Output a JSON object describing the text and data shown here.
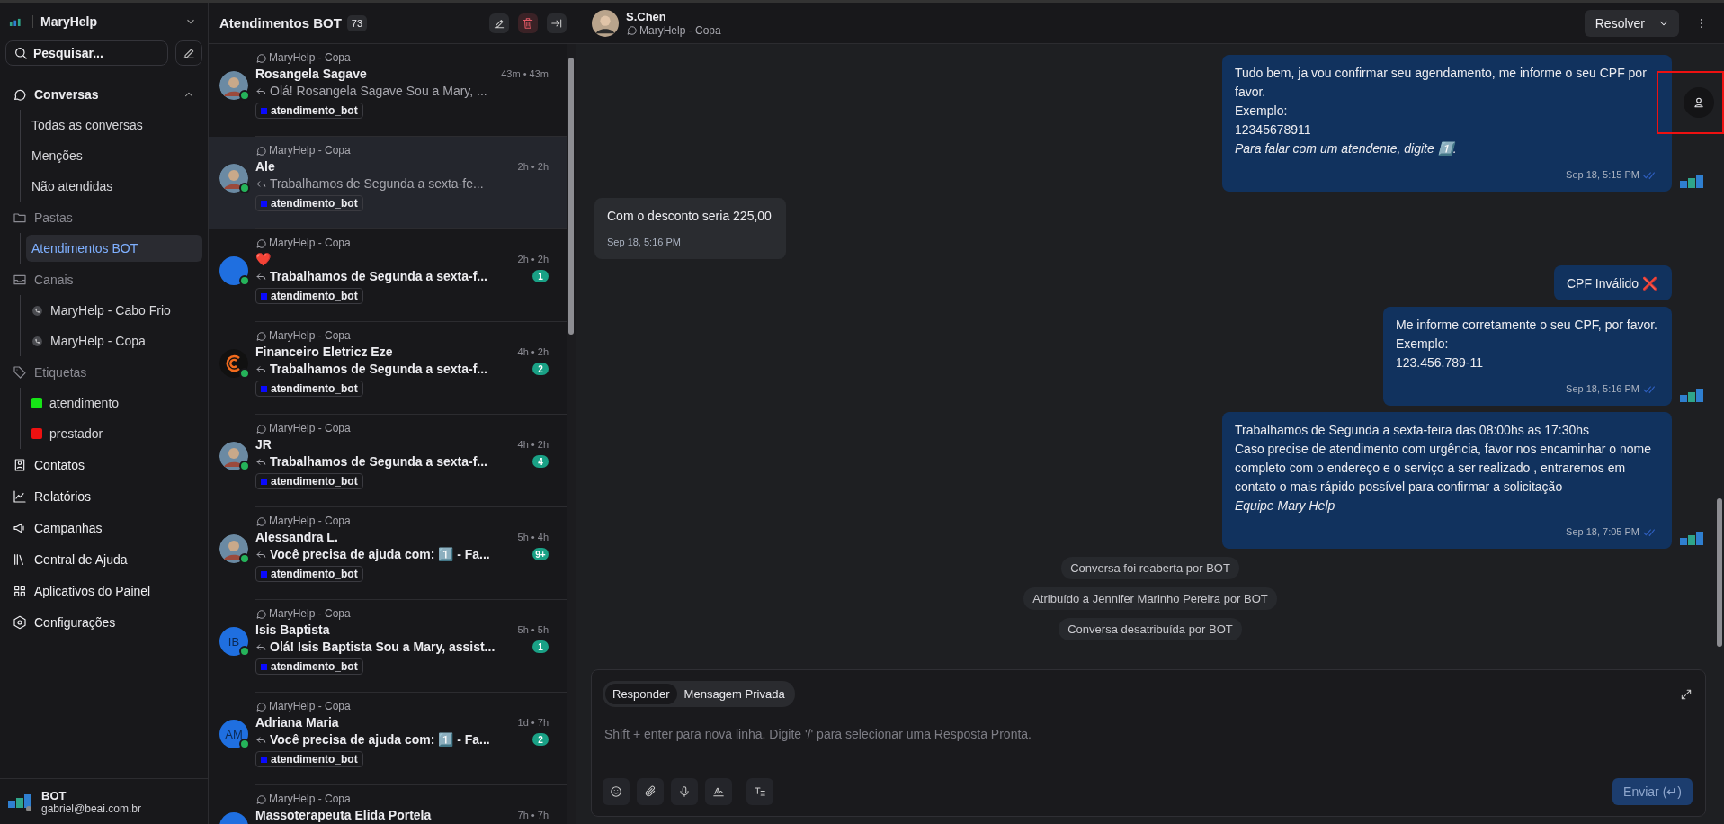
{
  "sidebar": {
    "brand": "MaryHelp",
    "search": {
      "label": "Pesquisar..."
    },
    "nav": [
      {
        "kind": "section",
        "label": "Conversas",
        "expanded": true,
        "children": [
          {
            "kind": "view",
            "label": "Todas as conversas",
            "selected": false
          },
          {
            "kind": "view",
            "label": "Menções",
            "selected": false
          },
          {
            "kind": "view",
            "label": "Não atendidas",
            "selected": false
          }
        ]
      },
      {
        "kind": "group",
        "label": "Pastas",
        "children": [
          {
            "kind": "folder",
            "label": "Atendimentos BOT",
            "selected": true
          }
        ]
      },
      {
        "kind": "group",
        "label": "Canais",
        "children": [
          {
            "kind": "channel",
            "label": "MaryHelp - Cabo Frio",
            "selected": false
          },
          {
            "kind": "channel",
            "label": "MaryHelp - Copa",
            "selected": false
          }
        ]
      },
      {
        "kind": "group",
        "label": "Etiquetas",
        "children": [
          {
            "kind": "label",
            "label": "atendimento",
            "selected": false,
            "color": "#16e316"
          },
          {
            "kind": "label",
            "label": "prestador",
            "selected": false,
            "color": "#ee1111"
          }
        ]
      },
      {
        "kind": "link",
        "label": "Contatos"
      },
      {
        "kind": "link",
        "label": "Relatórios"
      },
      {
        "kind": "link",
        "label": "Campanhas"
      },
      {
        "kind": "link",
        "label": "Central de Ajuda"
      },
      {
        "kind": "link",
        "label": "Aplicativos do Painel"
      },
      {
        "kind": "link",
        "label": "Configurações"
      }
    ],
    "user": {
      "name": "BOT",
      "email": "gabriel@beai.com.br"
    }
  },
  "conversation_list": {
    "title": "Atendimentos BOT",
    "count": "73",
    "items": [
      {
        "channel": "MaryHelp - Copa",
        "name": "Rosangela Sagave",
        "time": "43m • 43m",
        "preview": "Olá! Rosangela Sagave Sou a Mary, ...",
        "unread": false,
        "tag": "atendimento_bot",
        "avatar": {
          "kind": "photo"
        },
        "selected": false
      },
      {
        "channel": "MaryHelp - Copa",
        "name": "Ale",
        "time": "2h • 2h",
        "preview": "Trabalhamos de Segunda a sexta-fe...",
        "unread": false,
        "tag": "atendimento_bot",
        "avatar": {
          "kind": "photo"
        },
        "selected": true
      },
      {
        "channel": "MaryHelp - Copa",
        "name": "❤️",
        "time": "2h • 2h",
        "preview": "Trabalhamos de Segunda a sexta-f...",
        "unread": true,
        "unread_count": "1",
        "tag": "atendimento_bot",
        "avatar": {
          "kind": "plain"
        },
        "selected": false
      },
      {
        "channel": "MaryHelp - Copa",
        "name": "Financeiro Eletricz Eze",
        "time": "4h • 2h",
        "preview": "Trabalhamos de Segunda a sexta-f...",
        "unread": true,
        "unread_count": "2",
        "tag": "atendimento_bot",
        "avatar": {
          "kind": "logo"
        },
        "selected": false
      },
      {
        "channel": "MaryHelp - Copa",
        "name": "JR",
        "time": "4h • 2h",
        "preview": "Trabalhamos de Segunda a sexta-f...",
        "unread": true,
        "unread_count": "4",
        "tag": "atendimento_bot",
        "avatar": {
          "kind": "photo"
        },
        "selected": false
      },
      {
        "channel": "MaryHelp - Copa",
        "name": "Alessandra L.",
        "time": "5h • 4h",
        "preview": "Você precisa de ajuda com: 1️⃣ - Fa...",
        "unread": true,
        "unread_count": "9+",
        "tag": "atendimento_bot",
        "avatar": {
          "kind": "photo"
        },
        "selected": false
      },
      {
        "channel": "MaryHelp - Copa",
        "name": "Isis Baptista",
        "time": "5h • 5h",
        "preview": "Olá! Isis Baptista Sou a Mary, assist...",
        "unread": true,
        "unread_count": "1",
        "tag": "atendimento_bot",
        "avatar": {
          "kind": "initials",
          "text": "IB"
        },
        "selected": false
      },
      {
        "channel": "MaryHelp - Copa",
        "name": "Adriana Maria",
        "time": "1d • 7h",
        "preview": "Você precisa de ajuda com: 1️⃣ - Fa...",
        "unread": true,
        "unread_count": "2",
        "tag": "atendimento_bot",
        "avatar": {
          "kind": "initials",
          "text": "AM"
        },
        "selected": false
      },
      {
        "channel": "MaryHelp - Copa",
        "name": "Massoterapeuta Elida Portela",
        "time": "7h • 7h",
        "avatar": {
          "kind": "plain"
        },
        "selected": false
      }
    ]
  },
  "chat": {
    "contact": {
      "name": "S.Chen",
      "channel": "MaryHelp - Copa"
    },
    "resolve_label": "Resolver",
    "messages": [
      {
        "kind": "outgoing",
        "text": "Tudo bem, ja vou confirmar seu agendamento, me informe o seu CPF por favor.\nExemplo:\n12345678911\n*Para falar com um atendente, digite 1️⃣.*",
        "time": "Sep 18, 5:15 PM"
      },
      {
        "kind": "incoming",
        "text": "Com o desconto seria 225,00",
        "time": "Sep 18, 5:16 PM"
      },
      {
        "kind": "outgoing",
        "text": "CPF Inválido ❌"
      },
      {
        "kind": "outgoing",
        "text": "Me informe corretamente o seu CPF, por favor.\nExemplo:\n123.456.789-11",
        "time": "Sep 18, 5:16 PM"
      },
      {
        "kind": "outgoing",
        "text": "Trabalhamos de Segunda a sexta-feira das 08:00hs as 17:30hs\nCaso precise de atendimento com urgência, favor nos encaminhar o nome completo com o endereço e o serviço a ser realizado , entraremos em contato o mais rápido possível para confirmar a solicitação\n*Equipe Mary Help*",
        "time": "Sep 18, 7:05 PM"
      },
      {
        "kind": "activity",
        "text": "Conversa foi reaberta por BOT"
      },
      {
        "kind": "activity",
        "text": "Atribuído a Jennifer Marinho Pereira por BOT"
      },
      {
        "kind": "activity",
        "text": "Conversa desatribuída por BOT"
      }
    ],
    "composer": {
      "tabs": [
        {
          "label": "Responder",
          "selected": true
        },
        {
          "label": "Mensagem Privada",
          "selected": false
        }
      ],
      "placeholder": "Shift + enter para nova linha. Digite '/' para selecionar uma Resposta Pronta.",
      "send_label": "Enviar (↵)",
      "send_disabled": true
    }
  }
}
